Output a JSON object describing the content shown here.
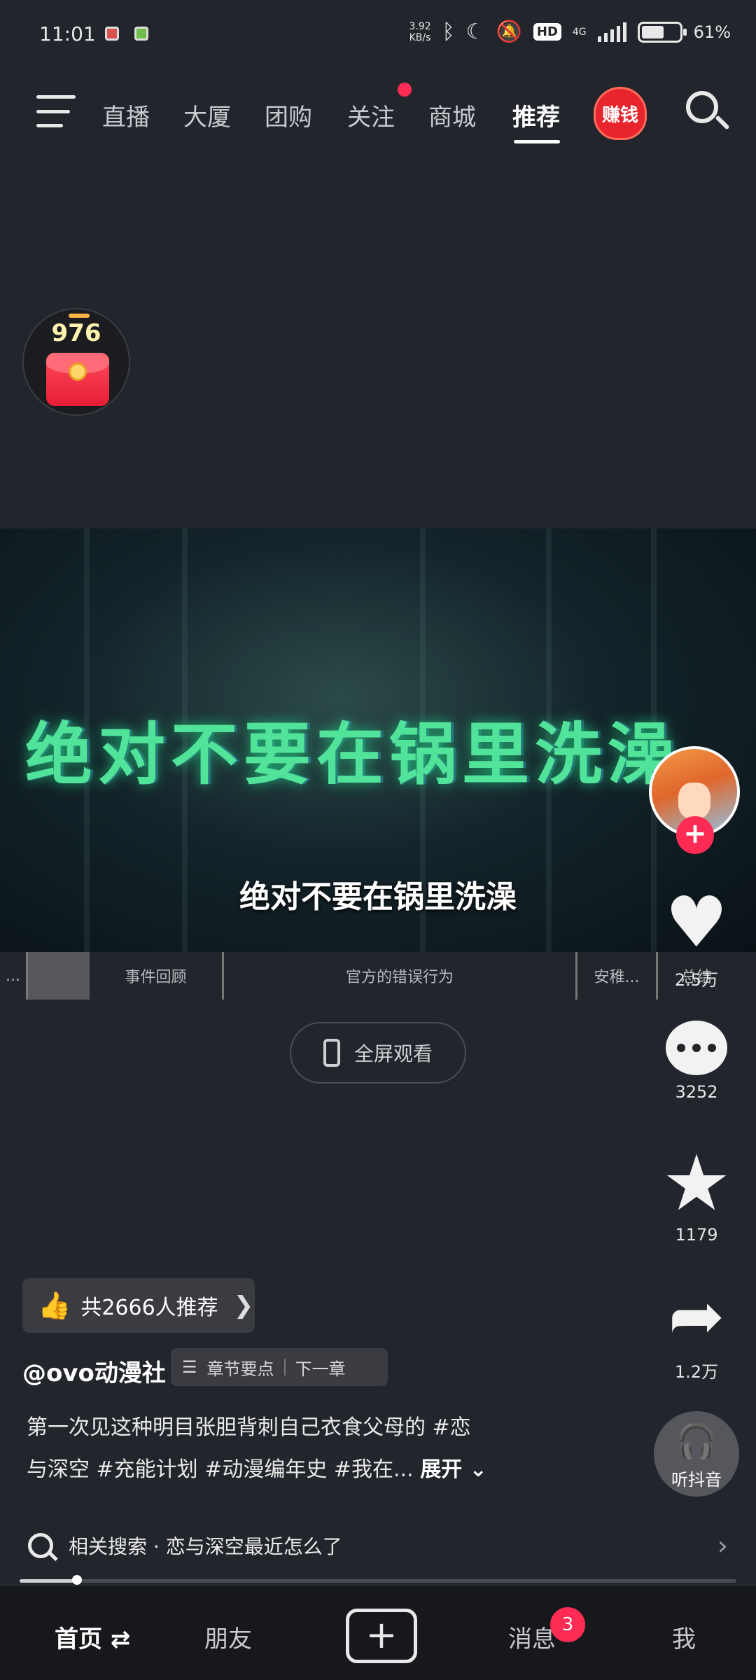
{
  "status_bar": {
    "time": "11:01",
    "net_speed_value": "3.92",
    "net_speed_unit": "KB/s",
    "hd": "HD",
    "network": "4G",
    "battery": "61%",
    "battery_level": 0.61
  },
  "top_nav": {
    "tabs": [
      "直播",
      "大厦",
      "团购",
      "关注",
      "商城",
      "推荐"
    ],
    "active_tab": "推荐",
    "earn_label": "赚钱"
  },
  "red_packet": {
    "count": "976"
  },
  "video": {
    "overlay_title": "绝对不要在锅里洗澡",
    "subtitle": "绝对不要在锅里洗澡"
  },
  "chapters": [
    "...",
    "事件回顾",
    "官方的错误行为",
    "安稚...",
    "总结"
  ],
  "fullscreen_label": "全屏观看",
  "rail": {
    "likes": "2.5万",
    "comments": "3252",
    "favorites": "1179",
    "shares": "1.2万",
    "listen_label": "听抖音"
  },
  "recommend_pill": "共2666人推荐",
  "author": "@ovo动漫社",
  "chapter_pill": {
    "points": "章节要点",
    "next": "下一章"
  },
  "description": {
    "line1": "第一次见这种明目张胆背刺自己衣食父母的 #恋",
    "line2": "与深空 #充能计划 #动漫编年史 #我在...",
    "expand": "展开"
  },
  "related_search": "相关搜索 · 恋与深空最近怎么了",
  "playback_progress": 0.08,
  "bottom_nav": {
    "home": "首页",
    "friends": "朋友",
    "messages": "消息",
    "messages_badge": "3",
    "me": "我"
  }
}
